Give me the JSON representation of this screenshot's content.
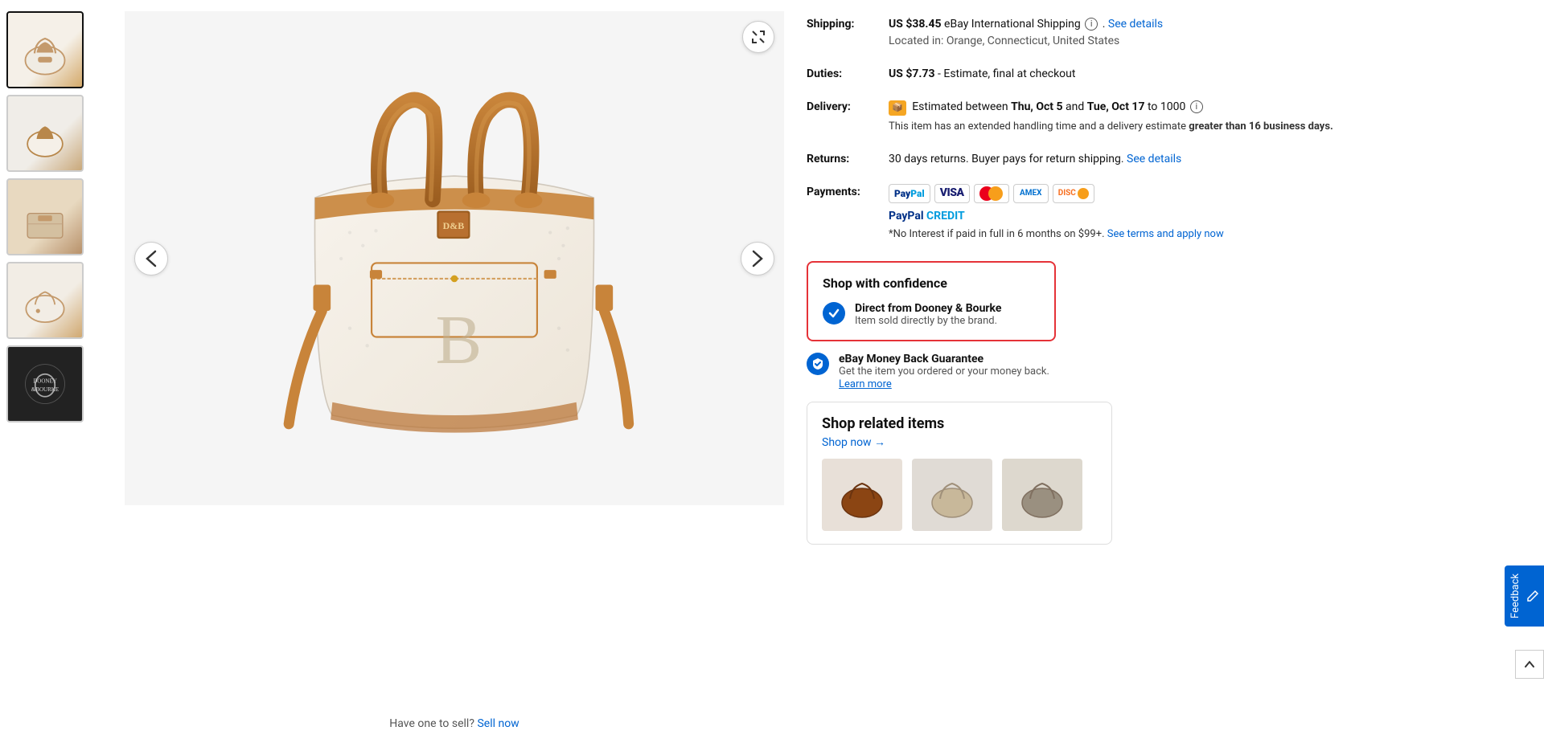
{
  "thumbnails": [
    {
      "id": "thumb-1",
      "alt": "Bag front view",
      "active": true
    },
    {
      "id": "thumb-2",
      "alt": "Bag side view"
    },
    {
      "id": "thumb-3",
      "alt": "Bag interior"
    },
    {
      "id": "thumb-4",
      "alt": "Bag detail"
    },
    {
      "id": "thumb-5",
      "alt": "Brand logo"
    }
  ],
  "main_image_alt": "Dooney & Bourke handbag",
  "sell_now": {
    "text": "Have one to sell?",
    "link_text": "Sell now"
  },
  "shipping": {
    "label": "Shipping:",
    "amount": "US $38.45",
    "carrier": "eBay International Shipping",
    "see_details_link": "See details",
    "location": "Located in: Orange, Connecticut, United States"
  },
  "duties": {
    "label": "Duties:",
    "amount": "US $7.73",
    "description": "- Estimate, final at checkout"
  },
  "delivery": {
    "label": "Delivery:",
    "estimated_text": "Estimated between",
    "date_from": "Thu, Oct 5",
    "date_to": "Tue, Oct 17",
    "to_text": "to 1000",
    "note_part1": "This item has an extended handling time and a delivery estimate",
    "note_bold": "greater than 16 business days."
  },
  "returns": {
    "label": "Returns:",
    "text": "30 days returns. Buyer pays for return shipping.",
    "see_details_link": "See details"
  },
  "payments": {
    "label": "Payments:",
    "icons": [
      "PayPal",
      "Visa",
      "Mastercard",
      "Amex",
      "Discover"
    ],
    "paypal_credit": "PayPal CREDIT",
    "note": "*No Interest if paid in full in 6 months on $99+.",
    "terms_link": "See terms and apply now"
  },
  "confidence": {
    "box_title": "Shop with confidence",
    "item_title": "Direct from Dooney & Bourke",
    "item_subtitle": "Item sold directly by the brand.",
    "money_back_title": "eBay Money Back Guarantee",
    "money_back_text": "Get the item you ordered or your money back.",
    "learn_more_link": "Learn more"
  },
  "shop_related": {
    "title": "Shop related items",
    "link_text": "Shop now →"
  },
  "feedback": {
    "label": "Feedback"
  },
  "nav": {
    "prev_label": "‹",
    "next_label": "›",
    "expand_label": "⤢"
  }
}
